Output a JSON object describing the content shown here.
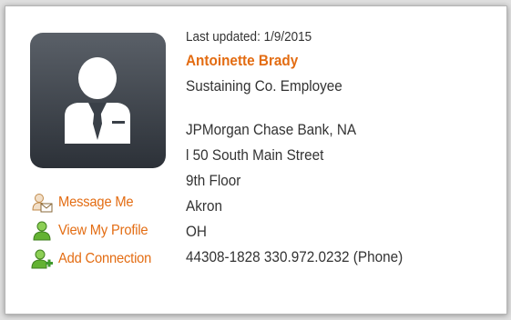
{
  "profile": {
    "last_updated": "Last updated: 1/9/2015",
    "name": "Antoinette Brady",
    "member_type": "Sustaining Co. Employee",
    "company": "JPMorgan Chase Bank, NA",
    "address1": "l 50 South Main Street",
    "address2": "9th Floor",
    "city": "Akron",
    "state": "OH",
    "zip_phone": "44308-1828  330.972.0232 (Phone)"
  },
  "actions": {
    "message": "Message Me",
    "view_profile": "View My Profile",
    "add_connection": "Add Connection"
  },
  "colors": {
    "accent": "#e36c12",
    "icon_green": "#3f9a2d",
    "avatar_dark": "#2c3138"
  },
  "icons": {
    "avatar": "person-silhouette-icon",
    "message": "user-envelope-icon",
    "view_profile": "user-icon",
    "add_connection": "user-add-icon"
  }
}
